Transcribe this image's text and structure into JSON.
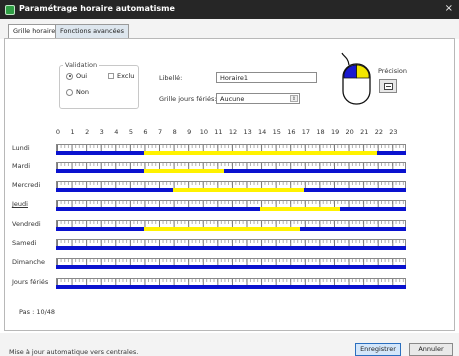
{
  "window": {
    "title": "Paramétrage horaire automatisme",
    "close_glyph": "×"
  },
  "tabs": [
    {
      "label": "Grille horaire",
      "active": true
    },
    {
      "label": "Fonctions avancées",
      "active": false
    }
  ],
  "validation": {
    "legend": "Validation",
    "options": [
      {
        "label": "Oui",
        "selected": true
      },
      {
        "label": "Non",
        "selected": false
      }
    ],
    "exclu_label": "Exclu",
    "exclu_checked": false
  },
  "form": {
    "libelle_label": "Libellé:",
    "libelle_value": "Horaire1",
    "feries_label": "Grille jours fériés:",
    "feries_value": "Aucune"
  },
  "precision": {
    "label": "Précision"
  },
  "mouse_icon": {
    "name": "mouse-icon",
    "left_button_color": "#1a1acf",
    "right_button_color": "#f2e600"
  },
  "colors": {
    "active": "#0a12cf",
    "inactive": "#fff200"
  },
  "hours": [
    "0",
    "1",
    "2",
    "3",
    "4",
    "5",
    "6",
    "7",
    "8",
    "9",
    "10",
    "11",
    "12",
    "13",
    "14",
    "15",
    "16",
    "17",
    "18",
    "19",
    "20",
    "21",
    "22",
    "23"
  ],
  "schedule": [
    {
      "day": "Lundi",
      "underlined": false,
      "inactive_from": 6,
      "inactive_to": 22
    },
    {
      "day": "Mardi",
      "underlined": false,
      "inactive_from": 6,
      "inactive_to": 11.5
    },
    {
      "day": "Mercredi",
      "underlined": false,
      "inactive_from": 8,
      "inactive_to": 17
    },
    {
      "day": "Jeudi",
      "underlined": true,
      "inactive_from": 14,
      "inactive_to": 19.5
    },
    {
      "day": "Vendredi",
      "underlined": false,
      "inactive_from": 6,
      "inactive_to": 16.75
    },
    {
      "day": "Samedi",
      "underlined": false,
      "inactive_from": null,
      "inactive_to": null
    },
    {
      "day": "Dimanche",
      "underlined": false,
      "inactive_from": null,
      "inactive_to": null
    },
    {
      "day": "Jours fériés",
      "underlined": false,
      "inactive_from": null,
      "inactive_to": null
    }
  ],
  "pas": {
    "text": "Pas : 10/48"
  },
  "status": {
    "text": "Mise à jour automatique vers centrales."
  },
  "buttons": {
    "save": "Enregistrer",
    "cancel": "Annuler"
  }
}
